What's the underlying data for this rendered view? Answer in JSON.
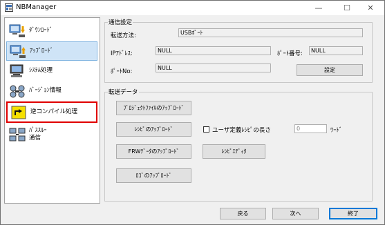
{
  "window": {
    "title": "NBManager",
    "controls": {
      "minimize": "—",
      "maximize": "☐",
      "close": "✕"
    }
  },
  "sidebar": {
    "items": [
      {
        "label": "ﾀﾞｳﾝﾛｰﾄﾞ",
        "icon": "download-icon"
      },
      {
        "label": "ｱｯﾌﾟﾛｰﾄﾞ",
        "icon": "upload-icon",
        "selected": true
      },
      {
        "label": "ｼｽﾃﾑ処理",
        "icon": "system-processing-icon"
      },
      {
        "label": "ﾊﾞｰｼﾞｮﾝ情報",
        "icon": "version-info-icon"
      },
      {
        "label": "逆コンパイル処理",
        "icon": "decompile-icon",
        "highlighted": true
      },
      {
        "label": "ﾊﾟｽｽﾙｰ",
        "label2": "通信",
        "icon": "pass-through-icon"
      }
    ]
  },
  "comm": {
    "legend": "通信設定",
    "method_label": "転送方法:",
    "method_value": "USBﾎﾟｰﾄ",
    "ip_label": "IPｱﾄﾞﾚｽ:",
    "ip_value": "NULL",
    "port_label": "ﾎﾟｰﾄ番号:",
    "port_value": "NULL",
    "portno_label": "ﾎﾟｰﾄNo:",
    "portno_value": "NULL",
    "settings_button": "設定"
  },
  "transfer": {
    "legend": "転送データ",
    "project_upload": "ﾌﾟﾛｼﾞｪｸﾄﾌｧｲﾙのｱｯﾌﾟﾛｰﾄﾞ",
    "recipe_upload": "ﾚｼﾋﾟのｱｯﾌﾟﾛｰﾄﾞ",
    "user_recipe_label": "ユーザ定義ﾚｼﾋﾟの長さ",
    "user_recipe_value": "0",
    "word_label": "ﾜｰﾄﾞ",
    "frw_upload": "FRWﾃﾞｰﾀのｱｯﾌﾟﾛｰﾄﾞ",
    "recipe_editor": "ﾚｼﾋﾟｴﾃﾞｨﾀ",
    "log_upload": "ﾛｺﾞのｱｯﾌﾟﾛｰﾄﾞ"
  },
  "footer": {
    "back": "戻る",
    "next": "次へ",
    "finish": "終了"
  }
}
